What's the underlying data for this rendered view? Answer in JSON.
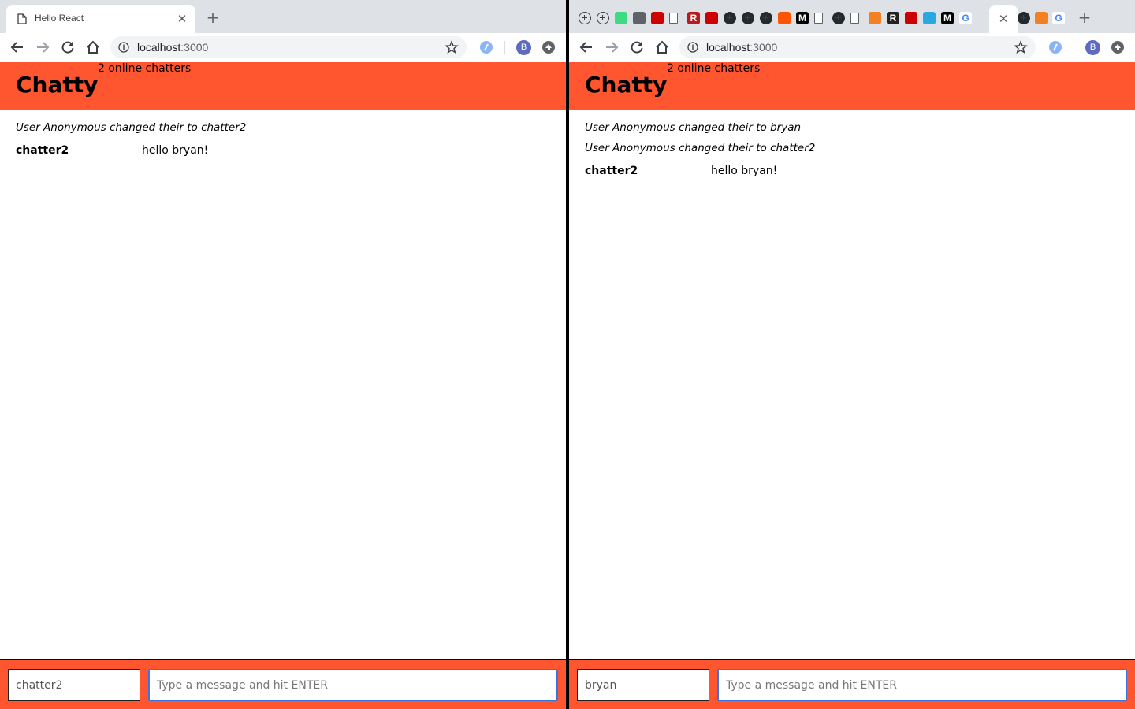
{
  "left": {
    "tab": {
      "title": "Hello React",
      "close": "✕"
    },
    "newtab": "+",
    "url": {
      "host": "localhost",
      "port": ":3000"
    },
    "avatar": "B",
    "app": {
      "brand": "Chatty",
      "online": "2 online chatters",
      "notifications": [
        "User Anonymous changed their to chatter2"
      ],
      "messages": [
        {
          "username": "chatter2",
          "content": "hello bryan!"
        }
      ],
      "name_value": "chatter2",
      "message_placeholder": "Type a message and hit ENTER"
    }
  },
  "right": {
    "pinned_tabs": [
      {
        "icon": "plus-circle-icon"
      },
      {
        "icon": "plus-circle-icon"
      },
      {
        "icon": "green-leaf-icon",
        "color": "#3ddc84"
      },
      {
        "icon": "docker-icon"
      },
      {
        "icon": "rails-icon",
        "color": "#cc0000"
      },
      {
        "icon": "document-icon"
      },
      {
        "icon": "r-icon",
        "label": "R",
        "color": "#b71c1c"
      },
      {
        "icon": "rails-icon",
        "color": "#cc0000"
      },
      {
        "icon": "github-icon"
      },
      {
        "icon": "github-icon"
      },
      {
        "icon": "github-icon"
      },
      {
        "icon": "soundcloud-icon",
        "color": "#ff5500"
      },
      {
        "icon": "medium-icon",
        "label": "M",
        "color": "#000000"
      },
      {
        "icon": "document-icon"
      },
      {
        "icon": "github-icon"
      },
      {
        "icon": "document-icon"
      },
      {
        "icon": "stackoverflow-icon",
        "color": "#f48024"
      },
      {
        "icon": "r-icon",
        "label": "R",
        "color": "#222222"
      },
      {
        "icon": "rails-icon",
        "color": "#cc0000"
      },
      {
        "icon": "grad-cap-icon",
        "color": "#2aa9e0"
      },
      {
        "icon": "medium-icon",
        "label": "M",
        "color": "#000000"
      },
      {
        "icon": "google-icon",
        "label": "G",
        "color": "#4285f4"
      }
    ],
    "after_tabs": [
      {
        "icon": "github-icon"
      },
      {
        "icon": "stackoverflow-icon",
        "color": "#f48024"
      },
      {
        "icon": "google-icon",
        "label": "G",
        "color": "#4285f4"
      }
    ],
    "tab_close": "✕",
    "newtab": "+",
    "url": {
      "host": "localhost",
      "port": ":3000"
    },
    "avatar": "B",
    "app": {
      "brand": "Chatty",
      "online": "2 online chatters",
      "notifications": [
        "User Anonymous changed their to bryan",
        "User Anonymous changed their to chatter2"
      ],
      "messages": [
        {
          "username": "chatter2",
          "content": "hello bryan!"
        }
      ],
      "name_value": "bryan",
      "message_placeholder": "Type a message and hit ENTER"
    }
  },
  "colors": {
    "app_accent": "#ff5630",
    "focus_ring": "#3b73e0",
    "tab_strip": "#dee1e6"
  }
}
